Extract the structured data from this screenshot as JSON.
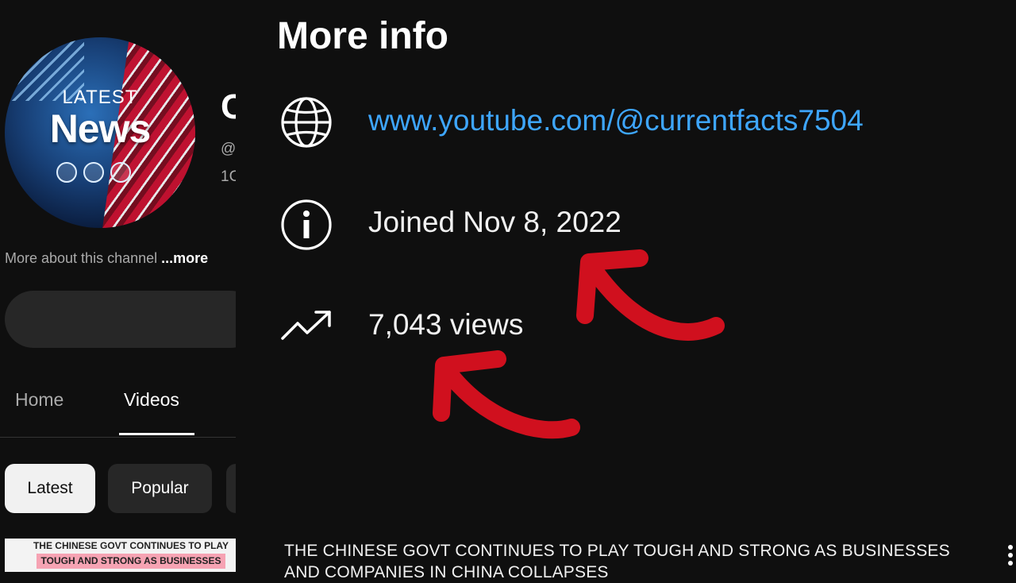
{
  "channel": {
    "avatar": {
      "top_text": "LATEST",
      "main_text": "News",
      "colors": {
        "blue": "#173e74",
        "red": "#c8102e"
      }
    },
    "name_fragment": "C",
    "handle_fragment": "@",
    "subs_fragment": "1C",
    "description_prefix": "More about this channel ",
    "more_label": "...more"
  },
  "tabs": [
    {
      "label": "Home",
      "active": false
    },
    {
      "label": "Videos",
      "active": true
    }
  ],
  "chips": [
    {
      "label": "Latest",
      "selected": true
    },
    {
      "label": "Popular",
      "selected": false
    }
  ],
  "more_info": {
    "title": "More info",
    "website": {
      "icon": "globe-icon",
      "text": "www.youtube.com/@currentfacts7504",
      "color": "#3ea6ff"
    },
    "joined": {
      "icon": "info-icon",
      "text": "Joined Nov 8, 2022"
    },
    "views": {
      "icon": "trending-up-icon",
      "text": "7,043 views"
    }
  },
  "annotations": {
    "arrow_color": "#d0101e",
    "arrows": [
      "red-arrow-to-joined-date",
      "red-arrow-to-views"
    ]
  },
  "video": {
    "thumbnail_line1": "THE CHINESE GOVT CONTINUES TO PLAY",
    "thumbnail_line2": "TOUGH AND STRONG AS BUSINESSES",
    "title": "THE CHINESE GOVT CONTINUES TO PLAY TOUGH AND STRONG AS BUSINESSES AND COMPANIES IN CHINA COLLAPSES"
  }
}
